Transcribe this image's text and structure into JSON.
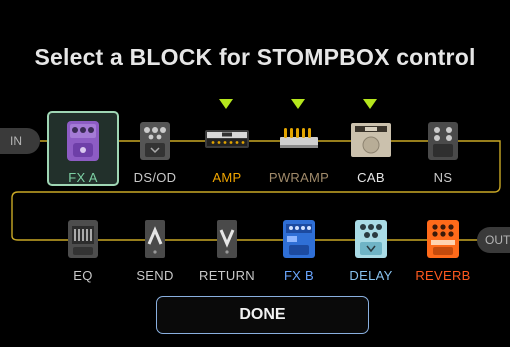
{
  "title": "Select a BLOCK for STOMPBOX control",
  "signal_in_label": "IN",
  "signal_out_label": "OUT",
  "colors": {
    "selected": "#7ccfa3",
    "default_label": "#c9c9c9",
    "amp_label": "#f0a500",
    "pwramp_label": "#a08a6a",
    "fxb_label": "#6aa6ff",
    "delay_label": "#89c3ef",
    "reverb_label": "#ff5a1f",
    "arrow": "#b5e61d",
    "chain_line": "#c9a826"
  },
  "row1": [
    {
      "id": "fx-a",
      "label": "FX A",
      "icon": "purple-pedal-icon",
      "selected": true,
      "stompbox_available": false
    },
    {
      "id": "ds-od",
      "label": "DS/OD",
      "icon": "overdrive-pedal-icon",
      "selected": false,
      "stompbox_available": false
    },
    {
      "id": "amp",
      "label": "AMP",
      "icon": "amp-head-icon",
      "selected": false,
      "stompbox_available": true
    },
    {
      "id": "pwramp",
      "label": "PWRAMP",
      "icon": "power-amp-icon",
      "selected": false,
      "stompbox_available": true
    },
    {
      "id": "cab",
      "label": "CAB",
      "icon": "cabinet-icon",
      "selected": false,
      "stompbox_available": true
    },
    {
      "id": "ns",
      "label": "NS",
      "icon": "noise-suppressor-pedal-icon",
      "selected": false,
      "stompbox_available": false
    }
  ],
  "row2": [
    {
      "id": "eq",
      "label": "EQ",
      "icon": "eq-pedal-icon"
    },
    {
      "id": "send",
      "label": "SEND",
      "icon": "send-icon"
    },
    {
      "id": "return",
      "label": "RETURN",
      "icon": "return-icon"
    },
    {
      "id": "fx-b",
      "label": "FX B",
      "icon": "blue-pedal-icon"
    },
    {
      "id": "delay",
      "label": "DELAY",
      "icon": "delay-pedal-icon"
    },
    {
      "id": "reverb",
      "label": "REVERB",
      "icon": "reverb-pedal-icon"
    }
  ],
  "done_label": "DONE"
}
